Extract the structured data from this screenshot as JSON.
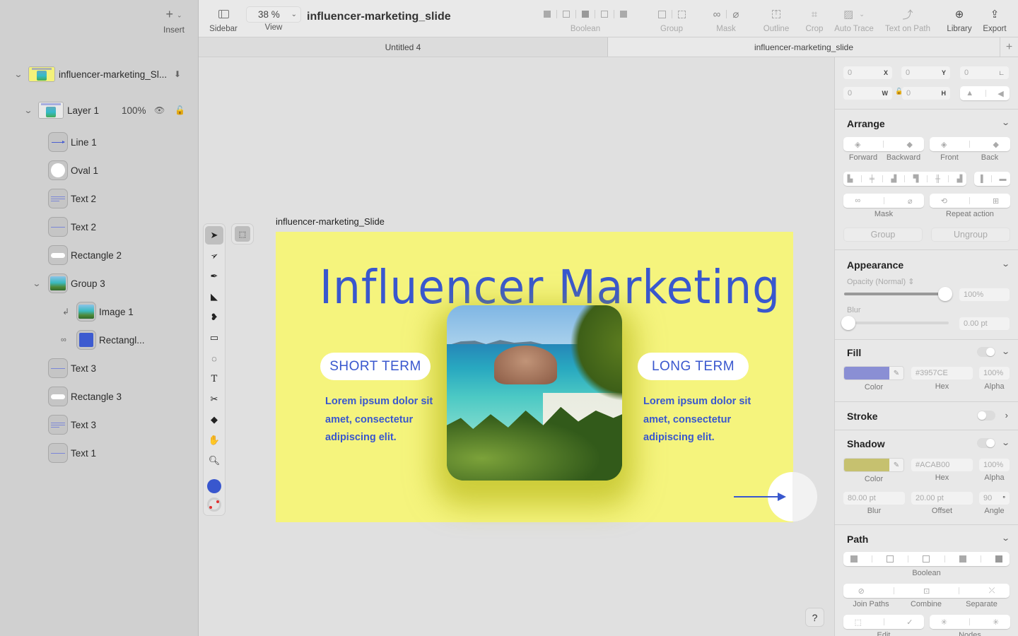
{
  "sidebar": {
    "insert_label": "Insert",
    "layers": [
      {
        "name": "influencer-marketing_Sl...",
        "type": "artboard"
      },
      {
        "name": "Layer 1",
        "opacity": "100%",
        "type": "layer"
      },
      {
        "name": "Line 1",
        "type": "line"
      },
      {
        "name": "Oval 1",
        "type": "oval"
      },
      {
        "name": "Text 2",
        "type": "text"
      },
      {
        "name": "Text 2",
        "type": "text"
      },
      {
        "name": "Rectangle 2",
        "type": "rect"
      },
      {
        "name": "Group 3",
        "type": "group"
      },
      {
        "name": "Image 1",
        "type": "image"
      },
      {
        "name": "Rectangl...",
        "type": "rect-mask"
      },
      {
        "name": "Text 3",
        "type": "text"
      },
      {
        "name": "Rectangle 3",
        "type": "rect"
      },
      {
        "name": "Text 3",
        "type": "text"
      },
      {
        "name": "Text 1",
        "type": "text"
      }
    ]
  },
  "toolbar": {
    "sidebar_label": "Sidebar",
    "view_label": "View",
    "zoom_value": "38 %",
    "document_title": "influencer-marketing_slide",
    "boolean_label": "Boolean",
    "group_label": "Group",
    "mask_label": "Mask",
    "outline_label": "Outline",
    "crop_label": "Crop",
    "auto_trace_label": "Auto Trace",
    "text_on_path_label": "Text on Path",
    "library_label": "Library",
    "export_label": "Export"
  },
  "tabs": [
    {
      "label": "Untitled 4",
      "active": false
    },
    {
      "label": "influencer-marketing_slide",
      "active": true
    }
  ],
  "tools": [
    "select",
    "direct-select",
    "pen",
    "vector",
    "brush",
    "rectangle",
    "lasso",
    "text",
    "knife",
    "eraser",
    "hand",
    "zoom"
  ],
  "canvas": {
    "artboard_label": "influencer-marketing_Slide",
    "slide": {
      "title": "Influencer Marketing",
      "left_pill": "SHORT TERM",
      "right_pill": "LONG TERM",
      "left_text": "Lorem ipsum dolor sit amet, consectetur adipiscing elit.",
      "right_text": "Lorem ipsum dolor sit amet, consectetur adipiscing elit.",
      "background_color": "#F5F47D",
      "accent_color": "#3957CE"
    },
    "help_label": "?"
  },
  "inspector": {
    "geometry": {
      "x": "0",
      "y": "0",
      "angle": "0",
      "w": "0",
      "h": "0",
      "x_label": "X",
      "y_label": "Y",
      "w_label": "W",
      "h_label": "H"
    },
    "arrange": {
      "title": "Arrange",
      "forward": "Forward",
      "backward": "Backward",
      "front": "Front",
      "back": "Back",
      "mask": "Mask",
      "repeat_action": "Repeat action",
      "group": "Group",
      "ungroup": "Ungroup"
    },
    "appearance": {
      "title": "Appearance",
      "opacity_label": "Opacity (Normal)",
      "opacity_value": "100%",
      "opacity_fraction": 1.0,
      "blur_label": "Blur",
      "blur_value": "0.00 pt",
      "blur_fraction": 0.0
    },
    "fill": {
      "title": "Fill",
      "enabled": true,
      "color": "#8A8FD4",
      "hex": "#3957CE",
      "alpha": "100%",
      "color_label": "Color",
      "hex_label": "Hex",
      "alpha_label": "Alpha"
    },
    "stroke": {
      "title": "Stroke",
      "enabled": false
    },
    "shadow": {
      "title": "Shadow",
      "enabled": true,
      "color": "#C6C16F",
      "hex": "#ACAB00",
      "alpha": "100%",
      "blur": "80.00 pt",
      "offset": "20.00 pt",
      "angle": "90",
      "color_label": "Color",
      "hex_label": "Hex",
      "alpha_label": "Alpha",
      "blur_label": "Blur",
      "offset_label": "Offset",
      "angle_label": "Angle"
    },
    "path": {
      "title": "Path",
      "boolean": "Boolean",
      "join_paths": "Join Paths",
      "combine": "Combine",
      "separate": "Separate",
      "edit": "Edit",
      "nodes": "Nodes"
    }
  }
}
